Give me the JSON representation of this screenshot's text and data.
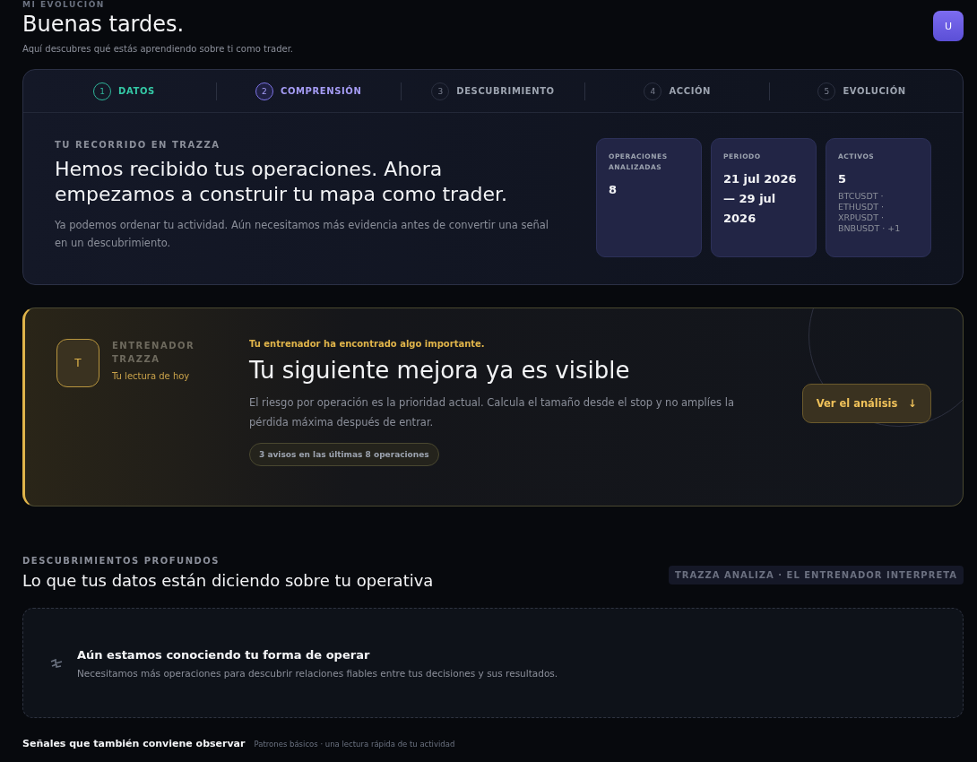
{
  "header": {
    "eyebrow": "MI EVOLUCIÓN",
    "title": "Buenas tardes.",
    "subtitle": "Aquí descubres qué estás aprendiendo sobre ti como trader.",
    "avatar": "U"
  },
  "steps": [
    {
      "number": "1",
      "label": "DATOS",
      "done": true,
      "selected": false
    },
    {
      "number": "2",
      "label": "COMPRENSIÓN",
      "done": false,
      "selected": true
    },
    {
      "number": "3",
      "label": "DESCUBRIMIENTO",
      "done": false,
      "selected": false
    },
    {
      "number": "4",
      "label": "ACCIÓN",
      "done": false,
      "selected": false
    },
    {
      "number": "5",
      "label": "EVOLUCIÓN",
      "done": false,
      "selected": false
    }
  ],
  "journey": {
    "eyebrow": "TU RECORRIDO EN TRAZZA",
    "title": "Hemos recibido tus operaciones. Ahora empezamos a construir tu mapa como trader.",
    "text": "Ya podemos ordenar tu actividad. Aún necesitamos más evidencia antes de convertir una señal en un descubrimiento.",
    "stats": [
      {
        "label": "OPERACIONES ANALIZADAS",
        "value": "8"
      },
      {
        "label": "PERIODO",
        "value": "21 jul 2026 — 29 jul 2026"
      },
      {
        "label": "ACTIVOS",
        "value": "5",
        "detail": "BTCUSDT · ETHUSDT · XRPUSDT · BNBUSDT · +1"
      }
    ]
  },
  "coach": {
    "avatar": "T",
    "name": "ENTRENADOR TRAZZA",
    "caption": "Tu lectura de hoy",
    "alert": "Tu entrenador ha encontrado algo importante.",
    "title": "Tu siguiente mejora ya es visible",
    "text": "El riesgo por operación es la prioridad actual. Calcula el tamaño desde el stop y no amplíes la pérdida máxima después de entrar.",
    "chip": "3 avisos en las últimas 8 operaciones",
    "button": "Ver el análisis",
    "button_arrow": "↓"
  },
  "discoveries": {
    "eyebrow": "DESCUBRIMIENTOS PROFUNDOS",
    "title": "Lo que tus datos están diciendo sobre tu operativa",
    "tag": "TRAZZA ANALIZA · EL ENTRENADOR INTERPRETA",
    "empty_title": "Aún estamos conociendo tu forma de operar",
    "empty_text": "Necesitamos más operaciones para descubrir relaciones fiables entre tus decisiones y sus resultados."
  },
  "signals": {
    "title": "Señales que también conviene observar",
    "subtitle": "Patrones básicos · una lectura rápida de tu actividad"
  }
}
